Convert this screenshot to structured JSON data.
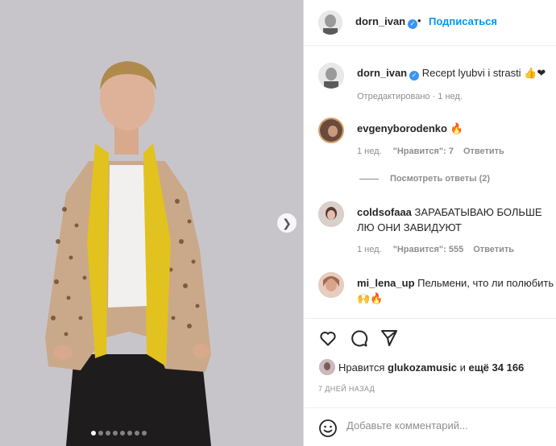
{
  "post": {
    "author": "dorn_ivan",
    "follow_label": "Подписаться",
    "separator": "•",
    "caption": "Recept lyubvi i strasti",
    "caption_emoji": "👍❤",
    "edited_meta": "Отредактировано · 1 нед."
  },
  "comments": [
    {
      "user": "evgenyborodenko",
      "text": "🔥",
      "age": "1 нед.",
      "likes": "\"Нравится\": 7",
      "reply": "Ответить",
      "view_replies": "Посмотреть ответы (2)"
    },
    {
      "user": "coldsofaaa",
      "text": "ЗАРАБАТЫВАЮ БОЛЬШЕ ЛЮ ОНИ ЗАВИДУЮТ",
      "age": "1 нед.",
      "likes": "\"Нравится\": 555",
      "reply": "Ответить"
    },
    {
      "user": "mi_lena_up",
      "text": "Пельмени, что ли полюбить 🙌🔥"
    }
  ],
  "likes_line": {
    "prefix": "Нравится",
    "user": "glukozamusic",
    "middle": "и",
    "rest": "ещё 34 166"
  },
  "date": "7 ДНЕЙ НАЗАД",
  "add_comment": {
    "placeholder": "Добавьте комментарий..."
  },
  "carousel": {
    "count": 8,
    "active": 1
  },
  "icons": [
    "verified-badge-icon",
    "heart-icon",
    "comment-icon",
    "share-icon",
    "emoji-icon",
    "chevron-right-icon"
  ],
  "colors": {
    "accent": "#0095f6",
    "verified": "#3897f0",
    "photo_bg": "#c9c6ca",
    "muted": "#8e8e8e"
  }
}
